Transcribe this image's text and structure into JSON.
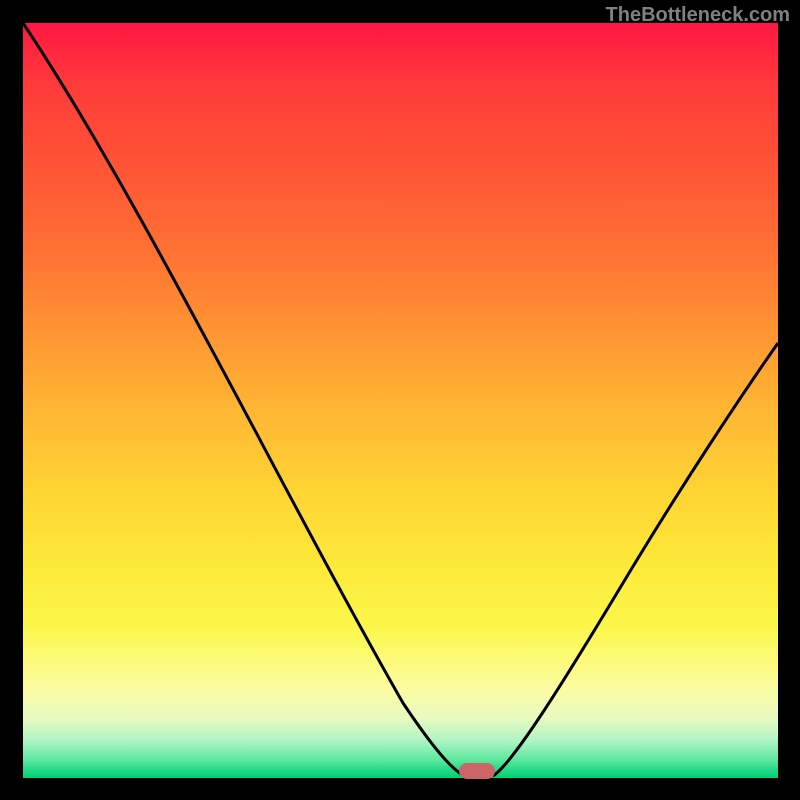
{
  "watermark": "TheBottleneck.com",
  "chart_data": {
    "type": "line",
    "title": "",
    "xlabel": "",
    "ylabel": "",
    "xlim": [
      0,
      100
    ],
    "ylim": [
      0,
      100
    ],
    "series": [
      {
        "name": "left-curve",
        "x": [
          0,
          4,
          8,
          12,
          16,
          20,
          24,
          28,
          32,
          36,
          40,
          44,
          48,
          52,
          55,
          57,
          58.5
        ],
        "y": [
          100,
          94,
          87,
          80,
          73,
          66,
          59,
          52,
          45,
          38,
          31,
          24,
          17,
          10,
          4,
          1,
          0
        ]
      },
      {
        "name": "right-curve",
        "x": [
          62,
          64,
          67,
          70,
          73,
          76,
          79,
          82,
          85,
          88,
          91,
          94,
          97,
          100
        ],
        "y": [
          0,
          3,
          8,
          13,
          18,
          23,
          28,
          33,
          38,
          43,
          48,
          52,
          56,
          60
        ]
      }
    ],
    "marker": {
      "x": 60,
      "y": 0
    },
    "gradient_stops": [
      {
        "pos": 0,
        "color": "#ff1744"
      },
      {
        "pos": 50,
        "color": "#ffc833"
      },
      {
        "pos": 80,
        "color": "#fbf74a"
      },
      {
        "pos": 100,
        "color": "#00d070"
      }
    ]
  }
}
